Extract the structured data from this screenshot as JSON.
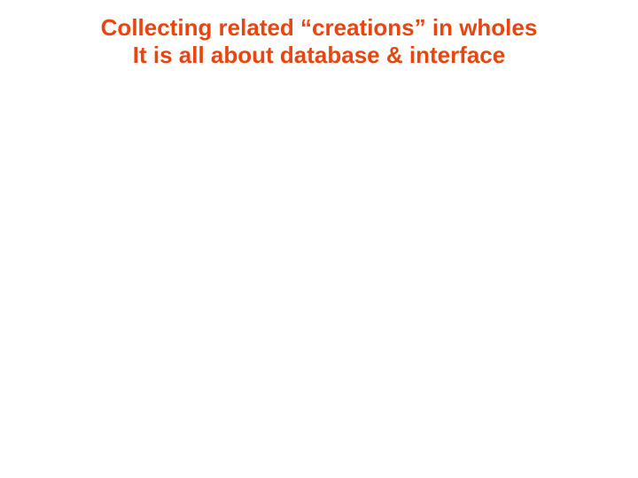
{
  "slide": {
    "title_line_1": "Collecting related “creations” in wholes",
    "title_line_2": "It is all about database & interface"
  },
  "colors": {
    "background": "#ffffff",
    "title": "#e84610"
  }
}
